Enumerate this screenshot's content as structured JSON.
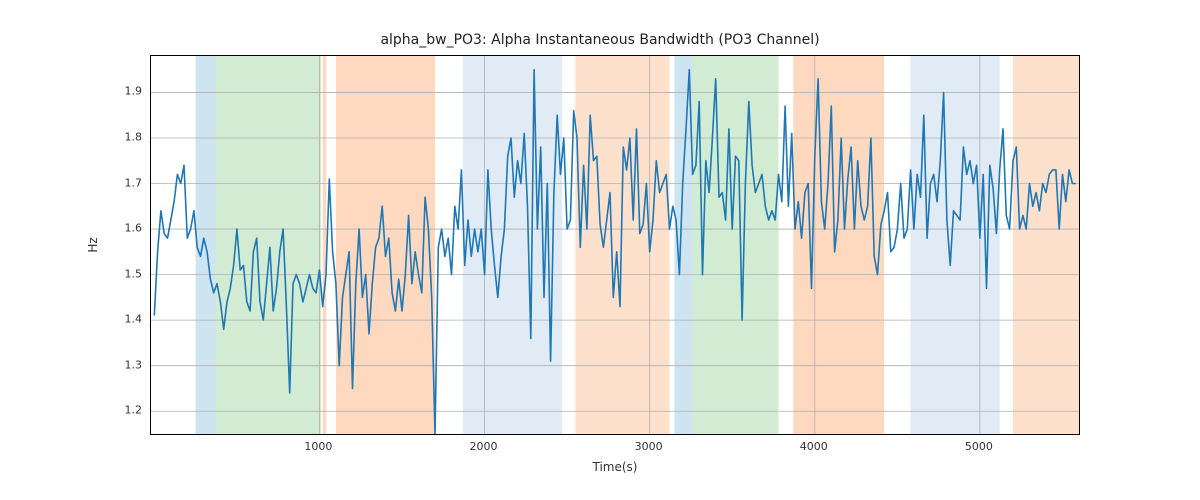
{
  "chart_data": {
    "type": "line",
    "title": "alpha_bw_PO3: Alpha Instantaneous Bandwidth (PO3 Channel)",
    "xlabel": "Time(s)",
    "ylabel": "Hz",
    "xlim": [
      -20,
      5600
    ],
    "ylim": [
      1.15,
      1.98
    ],
    "xticks": [
      1000,
      2000,
      3000,
      4000,
      5000
    ],
    "yticks": [
      1.2,
      1.3,
      1.4,
      1.5,
      1.6,
      1.7,
      1.8,
      1.9
    ],
    "regions": [
      {
        "x0": 250,
        "x1": 370,
        "color": "#6baed6",
        "alpha": 0.33
      },
      {
        "x0": 370,
        "x1": 1010,
        "color": "#74c476",
        "alpha": 0.33
      },
      {
        "x0": 1020,
        "x1": 1042,
        "color": "#fd8d3c",
        "alpha": 0.33
      },
      {
        "x0": 1100,
        "x1": 1700,
        "color": "#fd8d3c",
        "alpha": 0.33
      },
      {
        "x0": 1870,
        "x1": 2470,
        "color": "#c6dbef",
        "alpha": 0.55
      },
      {
        "x0": 2550,
        "x1": 3120,
        "color": "#fd8d3c",
        "alpha": 0.26
      },
      {
        "x0": 3150,
        "x1": 3260,
        "color": "#6baed6",
        "alpha": 0.33
      },
      {
        "x0": 3260,
        "x1": 3780,
        "color": "#74c476",
        "alpha": 0.33
      },
      {
        "x0": 3870,
        "x1": 4420,
        "color": "#fd8d3c",
        "alpha": 0.33
      },
      {
        "x0": 4580,
        "x1": 5120,
        "color": "#c6dbef",
        "alpha": 0.55
      },
      {
        "x0": 5200,
        "x1": 5600,
        "color": "#fd8d3c",
        "alpha": 0.26
      }
    ],
    "series": [
      {
        "name": "alpha_bw_PO3",
        "color": "#1f77b4",
        "x": [
          0,
          20,
          40,
          60,
          80,
          100,
          120,
          140,
          160,
          180,
          200,
          220,
          240,
          260,
          280,
          300,
          320,
          340,
          360,
          380,
          400,
          420,
          440,
          460,
          480,
          500,
          520,
          540,
          560,
          580,
          600,
          620,
          640,
          660,
          680,
          700,
          720,
          740,
          760,
          780,
          800,
          820,
          840,
          860,
          880,
          900,
          920,
          940,
          960,
          980,
          1000,
          1020,
          1040,
          1060,
          1080,
          1100,
          1120,
          1140,
          1160,
          1180,
          1200,
          1220,
          1240,
          1260,
          1280,
          1300,
          1320,
          1340,
          1360,
          1380,
          1400,
          1420,
          1440,
          1460,
          1480,
          1500,
          1520,
          1540,
          1560,
          1580,
          1600,
          1620,
          1640,
          1660,
          1680,
          1700,
          1720,
          1740,
          1760,
          1780,
          1800,
          1820,
          1840,
          1860,
          1880,
          1900,
          1920,
          1940,
          1960,
          1980,
          2000,
          2020,
          2040,
          2060,
          2080,
          2100,
          2120,
          2140,
          2160,
          2180,
          2200,
          2220,
          2240,
          2260,
          2280,
          2300,
          2320,
          2340,
          2360,
          2380,
          2400,
          2420,
          2440,
          2460,
          2480,
          2500,
          2520,
          2540,
          2560,
          2580,
          2600,
          2620,
          2640,
          2660,
          2680,
          2700,
          2720,
          2740,
          2760,
          2780,
          2800,
          2820,
          2840,
          2860,
          2880,
          2900,
          2920,
          2940,
          2960,
          2980,
          3000,
          3020,
          3040,
          3060,
          3080,
          3100,
          3120,
          3140,
          3160,
          3180,
          3200,
          3220,
          3240,
          3260,
          3280,
          3300,
          3320,
          3340,
          3360,
          3380,
          3400,
          3420,
          3440,
          3460,
          3480,
          3500,
          3520,
          3540,
          3560,
          3580,
          3600,
          3620,
          3640,
          3660,
          3680,
          3700,
          3720,
          3740,
          3760,
          3780,
          3800,
          3820,
          3840,
          3860,
          3880,
          3900,
          3920,
          3940,
          3960,
          3980,
          4000,
          4020,
          4040,
          4060,
          4080,
          4100,
          4120,
          4140,
          4160,
          4180,
          4200,
          4220,
          4240,
          4260,
          4280,
          4300,
          4320,
          4340,
          4360,
          4380,
          4400,
          4420,
          4440,
          4460,
          4480,
          4500,
          4520,
          4540,
          4560,
          4580,
          4600,
          4620,
          4640,
          4660,
          4680,
          4700,
          4720,
          4740,
          4760,
          4780,
          4800,
          4820,
          4840,
          4860,
          4880,
          4900,
          4920,
          4940,
          4960,
          4980,
          5000,
          5020,
          5040,
          5060,
          5080,
          5100,
          5120,
          5140,
          5160,
          5180,
          5200,
          5220,
          5240,
          5260,
          5280,
          5300,
          5320,
          5340,
          5360,
          5380,
          5400,
          5420,
          5440,
          5460,
          5480,
          5500,
          5520,
          5540,
          5560,
          5580
        ],
        "y": [
          1.41,
          1.55,
          1.64,
          1.59,
          1.58,
          1.62,
          1.66,
          1.72,
          1.7,
          1.74,
          1.58,
          1.6,
          1.64,
          1.56,
          1.54,
          1.58,
          1.55,
          1.49,
          1.46,
          1.48,
          1.44,
          1.38,
          1.44,
          1.47,
          1.52,
          1.6,
          1.51,
          1.52,
          1.44,
          1.42,
          1.55,
          1.58,
          1.44,
          1.4,
          1.48,
          1.56,
          1.42,
          1.47,
          1.55,
          1.6,
          1.43,
          1.24,
          1.48,
          1.5,
          1.48,
          1.44,
          1.47,
          1.5,
          1.47,
          1.46,
          1.51,
          1.43,
          1.5,
          1.71,
          1.55,
          1.48,
          1.3,
          1.45,
          1.5,
          1.55,
          1.25,
          1.48,
          1.6,
          1.45,
          1.5,
          1.37,
          1.48,
          1.56,
          1.58,
          1.65,
          1.54,
          1.58,
          1.46,
          1.42,
          1.49,
          1.42,
          1.5,
          1.63,
          1.48,
          1.55,
          1.5,
          1.46,
          1.67,
          1.6,
          1.45,
          1.15,
          1.56,
          1.6,
          1.54,
          1.58,
          1.5,
          1.65,
          1.6,
          1.73,
          1.52,
          1.62,
          1.54,
          1.6,
          1.55,
          1.6,
          1.5,
          1.73,
          1.6,
          1.52,
          1.45,
          1.54,
          1.6,
          1.76,
          1.8,
          1.67,
          1.75,
          1.7,
          1.81,
          1.65,
          1.36,
          1.95,
          1.6,
          1.78,
          1.45,
          1.7,
          1.31,
          1.68,
          1.85,
          1.72,
          1.8,
          1.6,
          1.62,
          1.86,
          1.8,
          1.56,
          1.74,
          1.6,
          1.85,
          1.75,
          1.76,
          1.61,
          1.56,
          1.62,
          1.68,
          1.45,
          1.55,
          1.43,
          1.78,
          1.73,
          1.8,
          1.62,
          1.82,
          1.59,
          1.61,
          1.7,
          1.55,
          1.62,
          1.75,
          1.68,
          1.7,
          1.72,
          1.6,
          1.65,
          1.62,
          1.5,
          1.7,
          1.82,
          1.95,
          1.72,
          1.74,
          1.88,
          1.5,
          1.75,
          1.68,
          1.8,
          1.93,
          1.67,
          1.68,
          1.62,
          1.82,
          1.6,
          1.76,
          1.75,
          1.4,
          1.7,
          1.88,
          1.74,
          1.68,
          1.7,
          1.72,
          1.65,
          1.62,
          1.64,
          1.62,
          1.72,
          1.66,
          1.87,
          1.65,
          1.81,
          1.6,
          1.66,
          1.58,
          1.68,
          1.7,
          1.47,
          1.76,
          1.93,
          1.66,
          1.6,
          1.7,
          1.87,
          1.55,
          1.62,
          1.8,
          1.6,
          1.71,
          1.78,
          1.6,
          1.75,
          1.65,
          1.62,
          1.65,
          1.8,
          1.54,
          1.5,
          1.61,
          1.64,
          1.68,
          1.55,
          1.56,
          1.6,
          1.7,
          1.58,
          1.6,
          1.73,
          1.6,
          1.72,
          1.67,
          1.85,
          1.58,
          1.7,
          1.72,
          1.66,
          1.75,
          1.9,
          1.62,
          1.52,
          1.64,
          1.63,
          1.62,
          1.78,
          1.72,
          1.75,
          1.7,
          1.74,
          1.58,
          1.72,
          1.47,
          1.74,
          1.69,
          1.59,
          1.73,
          1.82,
          1.63,
          1.6,
          1.75,
          1.78,
          1.6,
          1.63,
          1.6,
          1.7,
          1.65,
          1.68,
          1.64,
          1.7,
          1.68,
          1.72,
          1.73,
          1.73,
          1.6,
          1.72,
          1.66,
          1.73,
          1.7,
          1.7
        ]
      }
    ]
  }
}
